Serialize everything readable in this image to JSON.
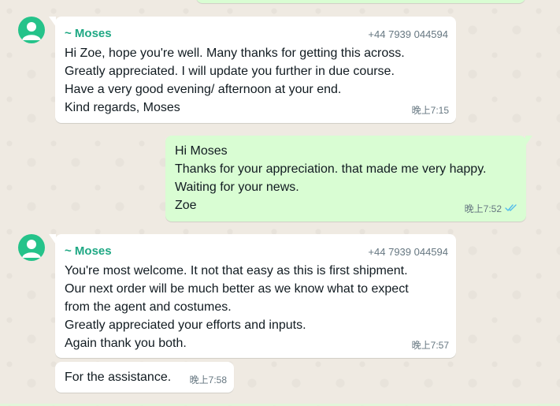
{
  "colors": {
    "wallpaper": "#efeae2",
    "incoming_bubble": "#ffffff",
    "outgoing_bubble": "#d9fdd3",
    "sender_name": "#1fa884",
    "avatar": "#25c38a",
    "read_ticks": "#53bdeb",
    "meta_text": "#667781"
  },
  "messages": [
    {
      "direction": "incoming",
      "sender": "~ Moses",
      "phone": "+44 7939 044594",
      "lines": [
        "Hi Zoe, hope you're well. Many thanks for getting this across.",
        "Greatly appreciated. I will update you further in due course.",
        "Have a very good evening/ afternoon at your end.",
        "Kind regards, Moses"
      ],
      "time": "晚上7:15"
    },
    {
      "direction": "outgoing",
      "lines": [
        "Hi Moses",
        "Thanks for your appreciation. that made me very happy.",
        "Waiting for your news.",
        "Zoe"
      ],
      "time": "晚上7:52",
      "status_icon": "double-check-read-icon"
    },
    {
      "direction": "incoming",
      "sender": "~ Moses",
      "phone": "+44 7939 044594",
      "lines": [
        "You're most welcome. It not that easy as this is first shipment.",
        "Our next order will be much better as we know what to expect",
        "from the agent and costumes.",
        "Greatly appreciated your efforts and inputs.",
        "Again thank you both."
      ],
      "time": "晚上7:57"
    },
    {
      "direction": "incoming",
      "lines": [
        "For the assistance."
      ],
      "time": "晚上7:58"
    }
  ]
}
